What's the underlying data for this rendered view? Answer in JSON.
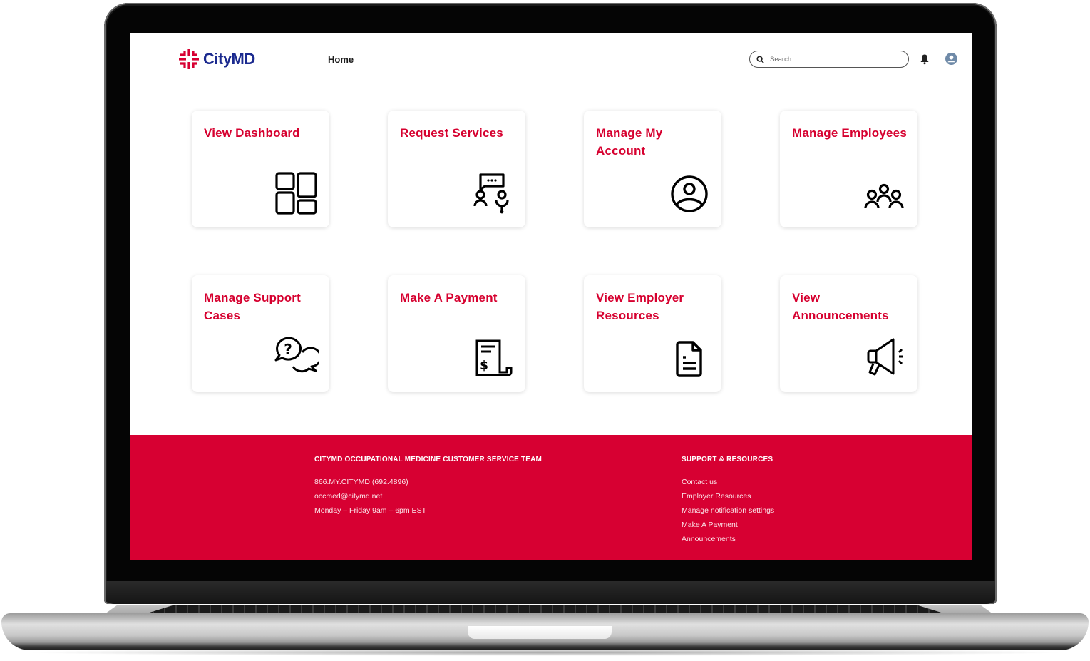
{
  "brand": {
    "name": "CityMD",
    "primary_color": "#d70032",
    "logo_text_color": "#1b2a8f"
  },
  "header": {
    "nav": [
      {
        "label": "Home"
      }
    ],
    "search": {
      "placeholder": "Search...",
      "value": "",
      "icon": "search-icon"
    },
    "icons": [
      "bell-icon",
      "user-avatar-icon"
    ]
  },
  "cards": [
    {
      "title": "View Dashboard",
      "icon": "dashboard-grid-icon"
    },
    {
      "title": "Request Services",
      "icon": "consultation-icon"
    },
    {
      "title": "Manage My Account",
      "icon": "user-circle-icon"
    },
    {
      "title": "Manage Employees",
      "icon": "group-icon"
    },
    {
      "title": "Manage Support Cases",
      "icon": "question-chat-icon"
    },
    {
      "title": "Make A Payment",
      "icon": "invoice-dollar-icon"
    },
    {
      "title": "View Employer Resources",
      "icon": "document-icon"
    },
    {
      "title": "View Announcements",
      "icon": "megaphone-icon"
    }
  ],
  "footer": {
    "contact": {
      "heading": "CITYMD OCCUPATIONAL MEDICINE CUSTOMER SERVICE TEAM",
      "phone": "866.MY.CITYMD (692.4896)",
      "email": "occmed@citymd.net",
      "hours": "Monday – Friday 9am – 6pm EST"
    },
    "resources": {
      "heading": "SUPPORT & RESOURCES",
      "links": [
        "Contact us",
        "Employer Resources",
        "Manage notification settings",
        "Make A Payment",
        "Announcements"
      ]
    }
  }
}
